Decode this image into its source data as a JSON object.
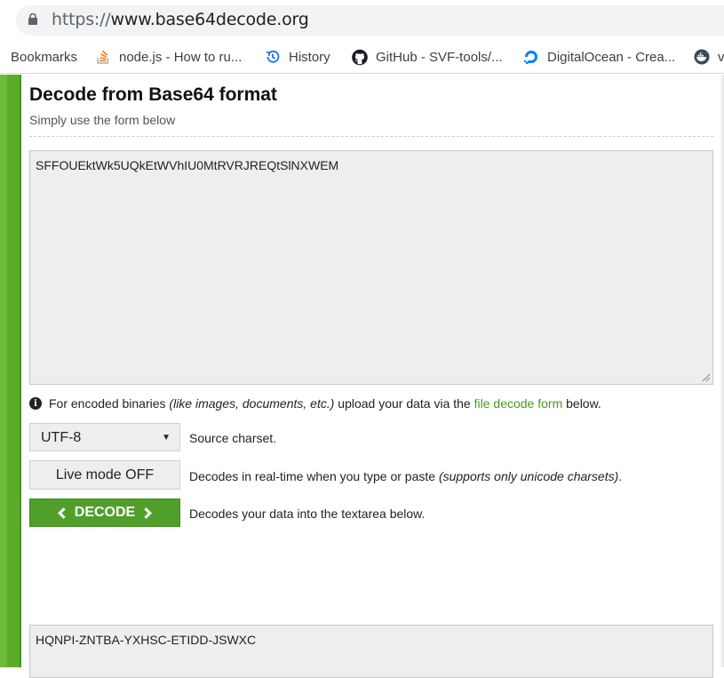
{
  "browser": {
    "url_scheme": "https://",
    "url_host": "www.base64decode.org"
  },
  "bookmarks_bar": {
    "items": [
      {
        "label": "Bookmarks",
        "icon": "none"
      },
      {
        "label": "node.js - How to ru...",
        "icon": "stackoverflow-icon"
      },
      {
        "label": "History",
        "icon": "history-icon"
      },
      {
        "label": "GitHub - SVF-tools/...",
        "icon": "github-icon"
      },
      {
        "label": "DigitalOcean - Crea...",
        "icon": "digitalocean-icon"
      },
      {
        "label": "v",
        "icon": "docker-icon"
      }
    ]
  },
  "page": {
    "title": "Decode from Base64 format",
    "subtitle": "Simply use the form below",
    "input_value": "SFFOUEktWk5UQkEtWVhIU0MtRVRJREQtSlNXWEM",
    "info": {
      "prefix": "For encoded binaries",
      "italic": "(like images, documents, etc.)",
      "middle": "upload your data via the",
      "link": "file decode form",
      "suffix": "below."
    },
    "charset": {
      "selected": "UTF-8",
      "label": "Source charset."
    },
    "live_mode": {
      "button": "Live mode OFF",
      "label_prefix": "Decodes in real-time when you type or paste",
      "label_italic": "(supports only unicode charsets)",
      "label_suffix": "."
    },
    "decode": {
      "button": "DECODE",
      "label": "Decodes your data into the textarea below."
    },
    "output_value": "HQNPI-ZNTBA-YXHSC-ETIDD-JSWXC"
  },
  "colors": {
    "accent_green": "#4f9f2a",
    "link_green": "#4a9a1f",
    "side_bar_green": "#5cac2b"
  }
}
